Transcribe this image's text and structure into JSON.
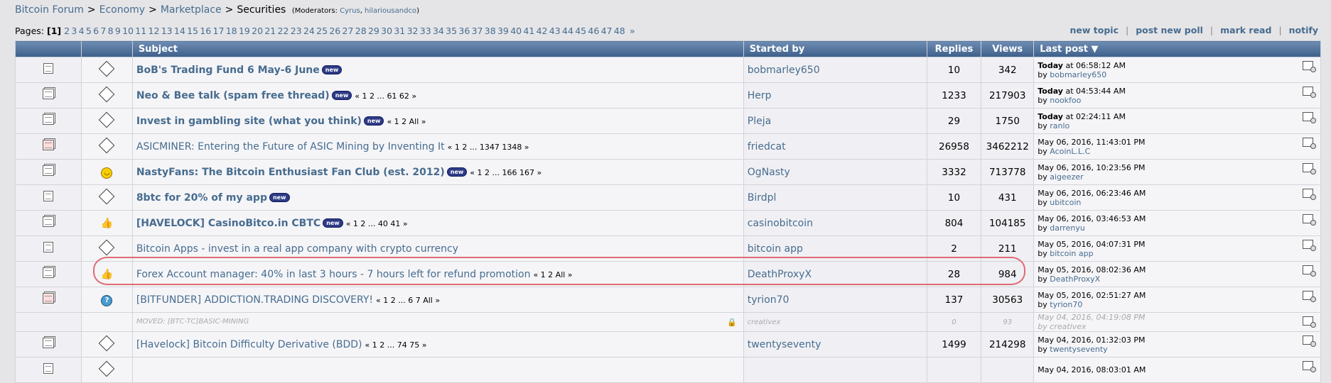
{
  "breadcrumb": {
    "items": [
      "Bitcoin Forum",
      "Economy",
      "Marketplace",
      "Securities"
    ],
    "separator": ">",
    "moderators_label": "(Moderators:",
    "moderators": [
      "Cyrus",
      "hilariousandco"
    ],
    "moderators_close": ")"
  },
  "pages": {
    "label": "Pages:",
    "current": "[1]",
    "numbers": [
      "2",
      "3",
      "4",
      "5",
      "6",
      "7",
      "8",
      "9",
      "10",
      "11",
      "12",
      "13",
      "14",
      "15",
      "16",
      "17",
      "18",
      "19",
      "20",
      "21",
      "22",
      "23",
      "24",
      "25",
      "26",
      "27",
      "28",
      "29",
      "30",
      "31",
      "32",
      "33",
      "34",
      "35",
      "36",
      "37",
      "38",
      "39",
      "40",
      "41",
      "42",
      "43",
      "44",
      "45",
      "46",
      "47",
      "48"
    ],
    "next": "»"
  },
  "actions": [
    "new topic",
    "post new poll",
    "mark read",
    "notify"
  ],
  "columns": {
    "subject": "Subject",
    "started_by": "Started by",
    "replies": "Replies",
    "views": "Views",
    "last_post": "Last post"
  },
  "new_badge": "new",
  "topics": [
    {
      "icon": "page",
      "msg": "msg",
      "title": "BoB's Trading Fund 6 May-6 June",
      "bold": true,
      "new": true,
      "pages": "",
      "starter": "bobmarley650",
      "replies": "10",
      "views": "342",
      "last_date_bold": "Today",
      "last_date": " at 06:58:12 AM",
      "last_by": "bobmarley650"
    },
    {
      "icon": "stack",
      "msg": "msg",
      "title": "Neo & Bee talk (spam free thread)",
      "bold": true,
      "new": true,
      "pages": "« 1 2 ... 61 62 »",
      "starter": "Herp",
      "replies": "1233",
      "views": "217903",
      "last_date_bold": "Today",
      "last_date": " at 04:53:44 AM",
      "last_by": "nookfoo"
    },
    {
      "icon": "stack",
      "msg": "msg",
      "title": "Invest in gambling site (what you think)",
      "bold": true,
      "new": true,
      "pages": "« 1 2  All »",
      "starter": "Pleja",
      "replies": "29",
      "views": "1750",
      "last_date_bold": "Today",
      "last_date": " at 02:24:11 AM",
      "last_by": "ranlo"
    },
    {
      "icon": "hot",
      "msg": "msg",
      "title": "ASICMINER: Entering the Future of ASIC Mining by Inventing It",
      "bold": false,
      "new": false,
      "pages": "« 1 2 ... 1347 1348 »",
      "starter": "friedcat",
      "replies": "26958",
      "views": "3462212",
      "last_date_bold": "",
      "last_date": "May 06, 2016, 11:43:01 PM",
      "last_by": "AcoinL.L.C"
    },
    {
      "icon": "stack",
      "msg": "smile",
      "title": "NastyFans: The Bitcoin Enthusiast Fan Club (est. 2012)",
      "bold": true,
      "new": true,
      "pages": "« 1 2 ... 166 167 »",
      "starter": "OgNasty",
      "replies": "3332",
      "views": "713778",
      "last_date_bold": "",
      "last_date": "May 06, 2016, 10:23:56 PM",
      "last_by": "aigeezer"
    },
    {
      "icon": "page",
      "msg": "msg",
      "title": "8btc for 20% of my app",
      "bold": true,
      "new": true,
      "pages": "",
      "starter": "Birdpl",
      "replies": "10",
      "views": "431",
      "last_date_bold": "",
      "last_date": "May 06, 2016, 06:23:46 AM",
      "last_by": "ubitcoin"
    },
    {
      "icon": "stack",
      "msg": "thumb",
      "title": "[HAVELOCK] CasinoBitco.in CBTC",
      "bold": true,
      "new": true,
      "pages": "« 1 2 ... 40 41 »",
      "starter": "casinobitcoin",
      "replies": "804",
      "views": "104185",
      "last_date_bold": "",
      "last_date": "May 06, 2016, 03:46:53 AM",
      "last_by": "darrenyu"
    },
    {
      "icon": "page",
      "msg": "msg",
      "title": "Bitcoin Apps - invest in a real app company with crypto currency",
      "bold": false,
      "new": false,
      "pages": "",
      "starter": "bitcoin app",
      "replies": "2",
      "views": "211",
      "last_date_bold": "",
      "last_date": "May 05, 2016, 04:07:31 PM",
      "last_by": "bitcoin app"
    },
    {
      "icon": "stack",
      "msg": "thumb",
      "title": "Forex Account manager: 40% in last 3 hours - 7 hours left for refund promotion",
      "bold": false,
      "new": false,
      "pages": "« 1 2  All »",
      "starter": "DeathProxyX",
      "replies": "28",
      "views": "984",
      "last_date_bold": "",
      "last_date": "May 05, 2016, 08:02:36 AM",
      "last_by": "DeathProxyX"
    },
    {
      "icon": "hotred",
      "msg": "quest",
      "title": "[BITFUNDER] ADDICTION.TRADING DISCOVERY!",
      "bold": false,
      "new": false,
      "pages": "« 1 2 ... 6 7  All »",
      "starter": "tyrion70",
      "replies": "137",
      "views": "30563",
      "last_date_bold": "",
      "last_date": "May 05, 2016, 02:51:27 AM",
      "last_by": "tyrion70"
    }
  ],
  "moved_topic": {
    "title": "MOVED: [BTC-TC]BASIC-MINING",
    "starter": "creativex",
    "replies": "0",
    "views": "93",
    "last_date": "May 04, 2016, 04:19:08 PM",
    "last_by": "creativex"
  },
  "after_moved": [
    {
      "icon": "stack",
      "msg": "msg",
      "title": "[Havelock] Bitcoin Difficulty Derivative (BDD)",
      "bold": false,
      "new": false,
      "pages": "« 1 2 ... 74 75 »",
      "starter": "twentyseventy",
      "replies": "1499",
      "views": "214298",
      "last_date_bold": "",
      "last_date": "May 04, 2016, 01:32:03 PM",
      "last_by": "twentyseventy"
    },
    {
      "icon": "page",
      "msg": "msg",
      "title": "",
      "bold": false,
      "new": false,
      "pages": "",
      "starter": "",
      "replies": "",
      "views": "",
      "last_date_bold": "",
      "last_date": "May 04, 2016, 08:03:01 AM",
      "last_by": ""
    }
  ],
  "by_label": "by "
}
